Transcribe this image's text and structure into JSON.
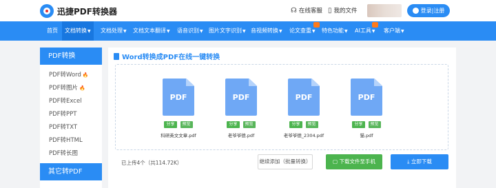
{
  "header": {
    "brand": "迅捷PDF转换器",
    "service_label": "在线客服",
    "my_files_label": "我的文件",
    "login_label": "登录|注册"
  },
  "nav": {
    "items": [
      {
        "label": "首页",
        "has_arrow": false
      },
      {
        "label": "文档转换",
        "has_arrow": true
      },
      {
        "label": "文档处理",
        "has_arrow": true
      },
      {
        "label": "文档文本翻译",
        "has_arrow": true
      },
      {
        "label": "语音识别",
        "has_arrow": true
      },
      {
        "label": "图片文字识别",
        "has_arrow": true
      },
      {
        "label": "音视频转换",
        "has_arrow": true
      },
      {
        "label": "论文查重",
        "has_arrow": true
      },
      {
        "label": "特色功能",
        "has_arrow": true
      },
      {
        "label": "AI工具",
        "has_arrow": true
      },
      {
        "label": "客户端",
        "has_arrow": true
      }
    ],
    "active_index": 1
  },
  "sidebar": {
    "heading": "PDF转换",
    "items": [
      {
        "label": "PDF转Word",
        "hot": true
      },
      {
        "label": "PDF转图片",
        "hot": true
      },
      {
        "label": "PDF转Excel",
        "hot": false
      },
      {
        "label": "PDF转PPT",
        "hot": false
      },
      {
        "label": "PDF转TXT",
        "hot": false
      },
      {
        "label": "PDF转HTML",
        "hot": false
      },
      {
        "label": "PDF转长图",
        "hot": false
      }
    ],
    "heading2": "其它转PDF"
  },
  "main": {
    "title": "Word转换成PDF在线一键转换",
    "files": [
      {
        "icon_text": "PDF",
        "share": "分享",
        "preview": "预览",
        "name": "科研英文文章.pdf"
      },
      {
        "icon_text": "PDF",
        "share": "分享",
        "preview": "预览",
        "name": "老爷爷德.pdf"
      },
      {
        "icon_text": "PDF",
        "share": "分享",
        "preview": "预览",
        "name": "老爷爷德_2304.pdf"
      },
      {
        "icon_text": "PDF",
        "share": "分享",
        "preview": "预览",
        "name": "猫.pdf"
      }
    ],
    "upload_count": "已上传4个（共114.72K）",
    "continue_btn": "继续添加（批量转换）",
    "download_phone_btn": "下载文件至手机",
    "download_btn": "立即下载"
  },
  "colors": {
    "primary": "#2a8cf4",
    "success": "#4cb44e",
    "hot": "#ff6a00"
  }
}
